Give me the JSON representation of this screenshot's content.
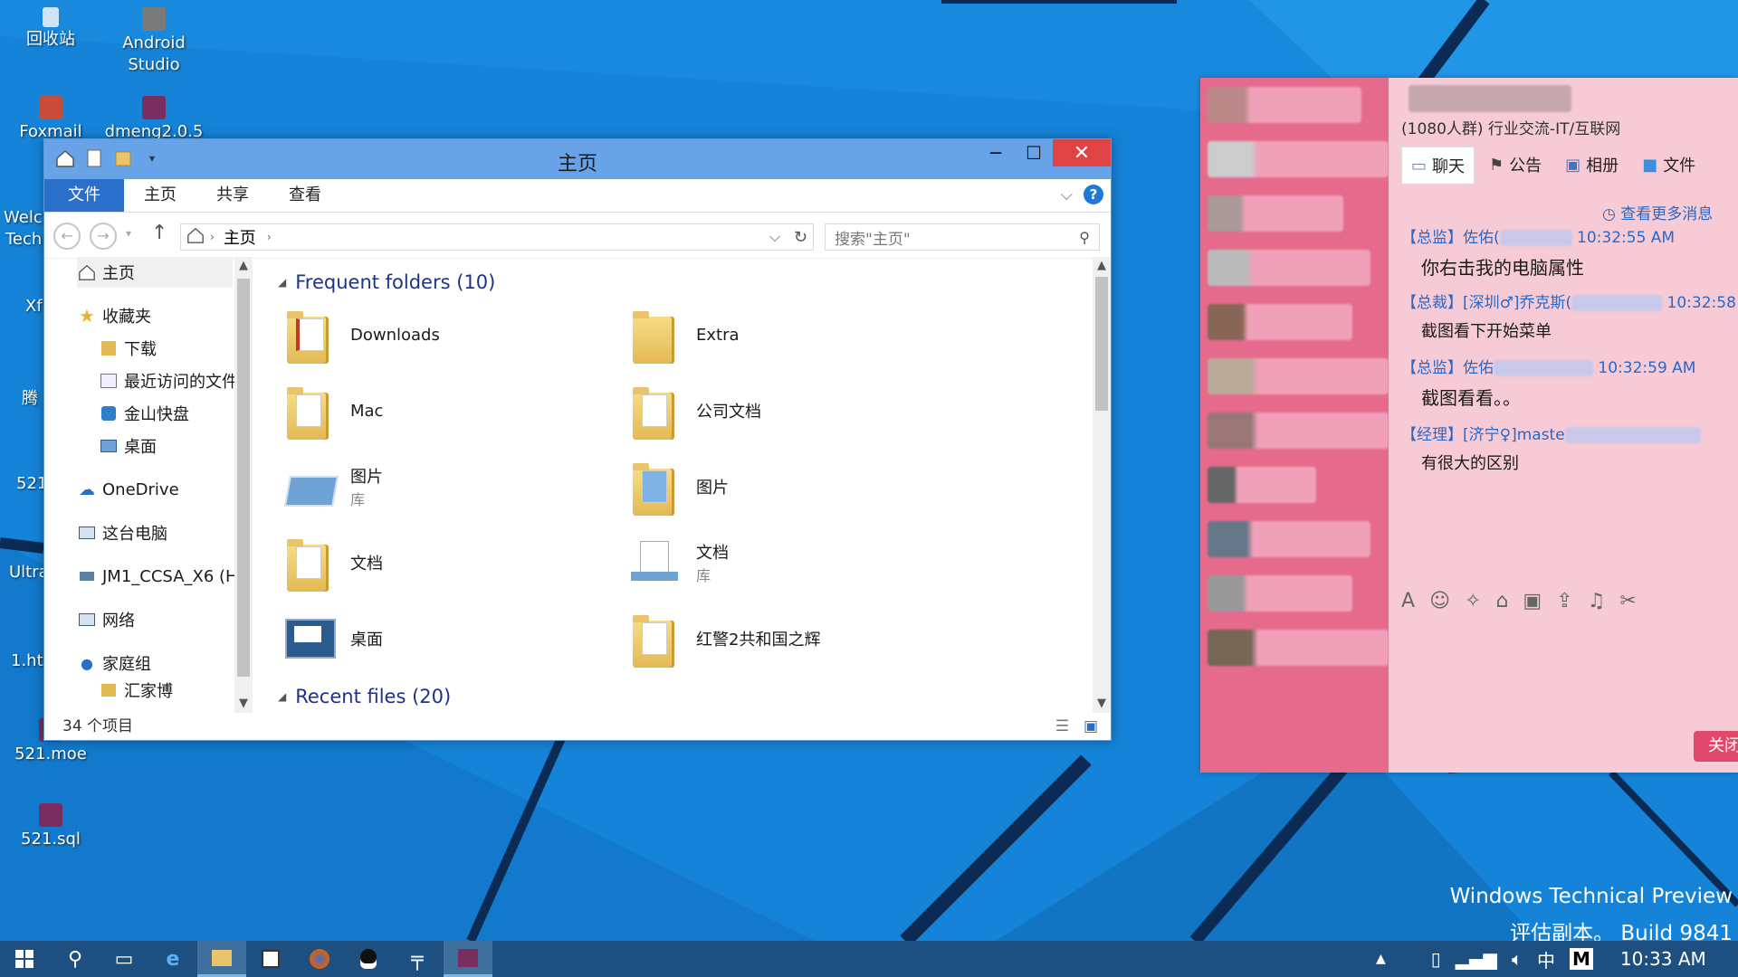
{
  "desktop": {
    "icons": [
      {
        "label": "回收站"
      },
      {
        "label": "Android Studio"
      },
      {
        "label": "Foxmail"
      },
      {
        "label": "dmeng2.0.5"
      },
      {
        "label": "521.moe"
      },
      {
        "label": "521.sql"
      }
    ],
    "partial_labels": [
      "Welc",
      "Tech",
      "Xf",
      "腾",
      "521",
      "Ultra",
      "1.ht"
    ]
  },
  "explorer": {
    "title": "主页",
    "ribbon_tabs": [
      "文件",
      "主页",
      "共享",
      "查看"
    ],
    "address_path": "主页",
    "search_placeholder": "搜索\"主页\"",
    "nav": {
      "home": "主页",
      "favorites": "收藏夹",
      "fav_items": [
        "下载",
        "最近访问的文件",
        "金山快盘",
        "桌面"
      ],
      "onedrive": "OneDrive",
      "thispc": "这台电脑",
      "drive": "JM1_CCSA_X6 (H",
      "network": "网络",
      "homegroup": "家庭组",
      "homegroup_child": "汇家博"
    },
    "frequent_header": "Frequent folders (10)",
    "recent_header": "Recent files (20)",
    "folders": [
      {
        "name": "Downloads",
        "sub": ""
      },
      {
        "name": "Extra",
        "sub": ""
      },
      {
        "name": "Mac",
        "sub": ""
      },
      {
        "name": "公司文档",
        "sub": ""
      },
      {
        "name": "图片",
        "sub": "库"
      },
      {
        "name": "图片",
        "sub": ""
      },
      {
        "name": "文档",
        "sub": ""
      },
      {
        "name": "文档",
        "sub": "库"
      },
      {
        "name": "桌面",
        "sub": ""
      },
      {
        "name": "红警2共和国之辉",
        "sub": ""
      }
    ],
    "status": "34 个项目"
  },
  "chat": {
    "group_name": "(1080人群) 行业交流-IT/互联网",
    "tabs": [
      "聊天",
      "公告",
      "相册",
      "文件"
    ],
    "more_messages": "查看更多消息",
    "messages": [
      {
        "tag": "【总监】佐佑(",
        "time": "10:32:55 AM",
        "text": "你右击我的电脑属性"
      },
      {
        "tag": "【总裁】[深圳♂]乔克斯(",
        "time": "10:32:58",
        "text": "截图看下开始菜单"
      },
      {
        "tag": "【总监】佐佑",
        "time": "10:32:59 AM",
        "text": "截图看看。。"
      },
      {
        "tag": "【经理】[济宁♀]maste",
        "time": "",
        "text": "有很大的区别"
      }
    ],
    "close_button": "关闭"
  },
  "watermark": {
    "line1": "Windows Technical Preview",
    "line2": "评估副本。 Build 9841"
  },
  "taskbar": {
    "ime": "中",
    "time": "10:33 AM"
  }
}
